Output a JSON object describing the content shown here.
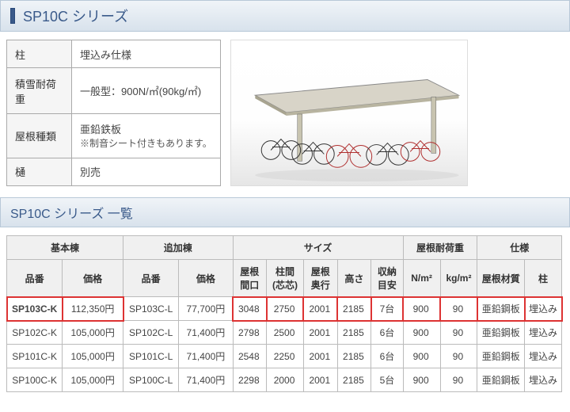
{
  "title": "SP10C シリーズ",
  "spec": {
    "rows": [
      {
        "label": "柱",
        "value": "埋込み仕様"
      },
      {
        "label": "積雪耐荷重",
        "value": "一般型：900N/㎡(90kg/㎡)"
      },
      {
        "label": "屋根種類",
        "value": "亜鉛鉄板",
        "note": "※制音シート付きもあります。"
      },
      {
        "label": "樋",
        "value": "別売"
      }
    ]
  },
  "list_title": "SP10C シリーズ 一覧",
  "headers": {
    "group_basic": "基本棟",
    "group_add": "追加棟",
    "group_size": "サイズ",
    "group_load": "屋根耐荷重",
    "group_spec": "仕様",
    "hinban": "品番",
    "kakaku": "価格",
    "yane_makuchi": "屋根\n間口",
    "hashira_kan": "柱間\n(芯芯)",
    "yane_okuyuki": "屋根\n奥行",
    "takasa": "高さ",
    "shuno": "収納\n目安",
    "npm2": "N/m²",
    "kgpm2": "kg/m²",
    "yane_zai": "屋根材質",
    "hashira": "柱"
  },
  "rows": [
    {
      "hl": true,
      "b_hin": "SP103C-K",
      "b_price": "112,350円",
      "a_hin": "SP103C-L",
      "a_price": "77,700円",
      "w": "3048",
      "span": "2750",
      "depth": "2001",
      "height": "2185",
      "cap": "7台",
      "n": "900",
      "kg": "90",
      "roof": "亜鉛鋼板",
      "post": "埋込み"
    },
    {
      "hl": false,
      "b_hin": "SP102C-K",
      "b_price": "105,000円",
      "a_hin": "SP102C-L",
      "a_price": "71,400円",
      "w": "2798",
      "span": "2500",
      "depth": "2001",
      "height": "2185",
      "cap": "6台",
      "n": "900",
      "kg": "90",
      "roof": "亜鉛鋼板",
      "post": "埋込み"
    },
    {
      "hl": false,
      "b_hin": "SP101C-K",
      "b_price": "105,000円",
      "a_hin": "SP101C-L",
      "a_price": "71,400円",
      "w": "2548",
      "span": "2250",
      "depth": "2001",
      "height": "2185",
      "cap": "6台",
      "n": "900",
      "kg": "90",
      "roof": "亜鉛鋼板",
      "post": "埋込み"
    },
    {
      "hl": false,
      "b_hin": "SP100C-K",
      "b_price": "105,000円",
      "a_hin": "SP100C-L",
      "a_price": "71,400円",
      "w": "2298",
      "span": "2000",
      "depth": "2001",
      "height": "2185",
      "cap": "5台",
      "n": "900",
      "kg": "90",
      "roof": "亜鉛鋼板",
      "post": "埋込み"
    }
  ],
  "chart_data": {
    "type": "table",
    "title": "SP10C シリーズ 一覧",
    "columns": [
      "基本棟品番",
      "基本棟価格",
      "追加棟品番",
      "追加棟価格",
      "屋根間口",
      "柱間(芯芯)",
      "屋根奥行",
      "高さ",
      "収納目安",
      "N/m²",
      "kg/m²",
      "屋根材質",
      "柱"
    ],
    "rows": [
      [
        "SP103C-K",
        "112,350円",
        "SP103C-L",
        "77,700円",
        3048,
        2750,
        2001,
        2185,
        "7台",
        900,
        90,
        "亜鉛鋼板",
        "埋込み"
      ],
      [
        "SP102C-K",
        "105,000円",
        "SP102C-L",
        "71,400円",
        2798,
        2500,
        2001,
        2185,
        "6台",
        900,
        90,
        "亜鉛鋼板",
        "埋込み"
      ],
      [
        "SP101C-K",
        "105,000円",
        "SP101C-L",
        "71,400円",
        2548,
        2250,
        2001,
        2185,
        "6台",
        900,
        90,
        "亜鉛鋼板",
        "埋込み"
      ],
      [
        "SP100C-K",
        "105,000円",
        "SP100C-L",
        "71,400円",
        2298,
        2000,
        2001,
        2185,
        "5台",
        900,
        90,
        "亜鉛鋼板",
        "埋込み"
      ]
    ]
  }
}
